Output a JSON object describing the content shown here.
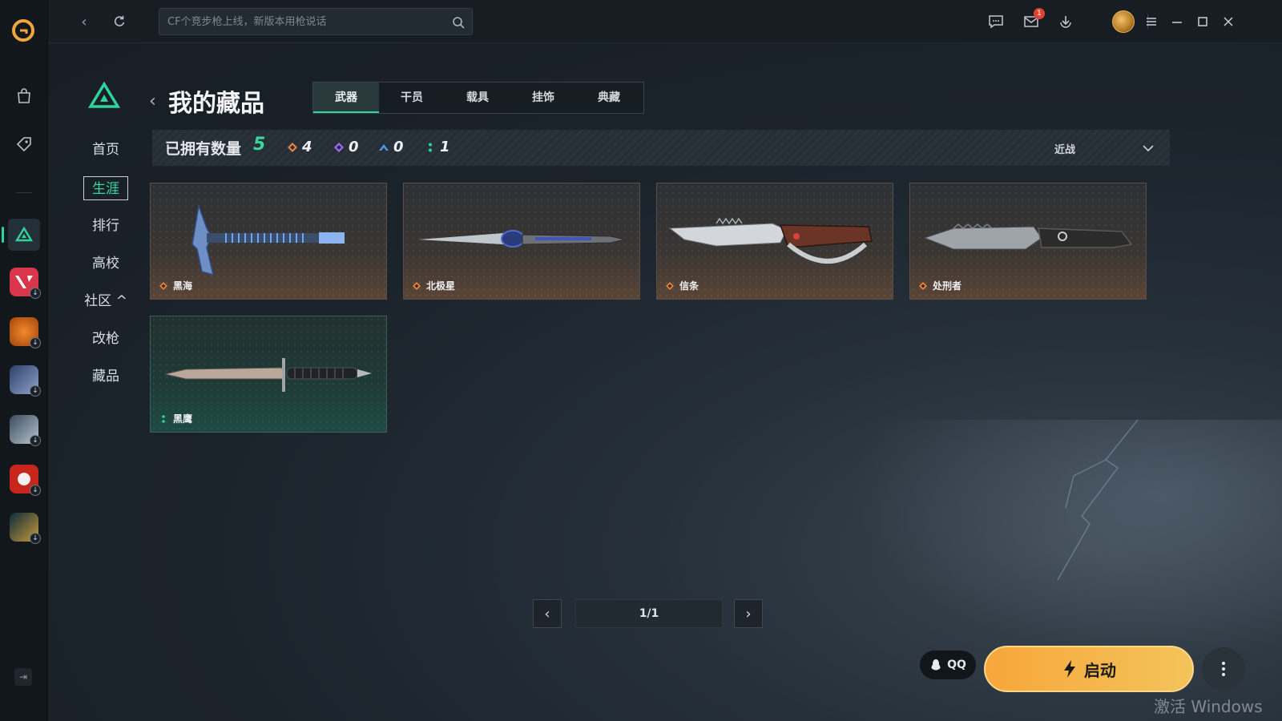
{
  "topbar": {
    "search_placeholder": "CF个竞步枪上线，新版本用枪说话",
    "mail_badge": "1"
  },
  "sidebar": {
    "items": [
      {
        "label": "首页"
      },
      {
        "label": "生涯"
      },
      {
        "label": "排行"
      },
      {
        "label": "高校"
      },
      {
        "label": "社区 ^"
      },
      {
        "label": "改枪"
      },
      {
        "label": "藏品"
      }
    ],
    "active_index": 1
  },
  "header": {
    "title": "我的藏品",
    "tabs": [
      {
        "label": "武器"
      },
      {
        "label": "干员"
      },
      {
        "label": "载具"
      },
      {
        "label": "挂饰"
      },
      {
        "label": "典藏"
      }
    ],
    "active_tab": 0
  },
  "stats": {
    "owned_label": "已拥有数量",
    "owned_count": "5",
    "rarity_counts": [
      {
        "color": "#e8843c",
        "count": "4"
      },
      {
        "color": "#9b6bf0",
        "count": "0"
      },
      {
        "color": "#4a9ae8",
        "count": "0"
      },
      {
        "color": "#2fd39b",
        "count": "1"
      }
    ],
    "filter_value": "近战"
  },
  "items": [
    {
      "name": "黑海",
      "rarity": "orange",
      "weapon": "axe-icon"
    },
    {
      "name": "北极星",
      "rarity": "orange",
      "weapon": "dagger-icon"
    },
    {
      "name": "信条",
      "rarity": "orange",
      "weapon": "knuckle-knife-icon"
    },
    {
      "name": "处刑者",
      "rarity": "orange",
      "weapon": "serrated-knife-icon"
    },
    {
      "name": "黑鹰",
      "rarity": "green",
      "weapon": "combat-knife-icon"
    }
  ],
  "pagination": {
    "label": "1/1"
  },
  "bottom": {
    "qq_label": "QQ",
    "launch_label": "启动",
    "watermark": "激活 Windows"
  }
}
